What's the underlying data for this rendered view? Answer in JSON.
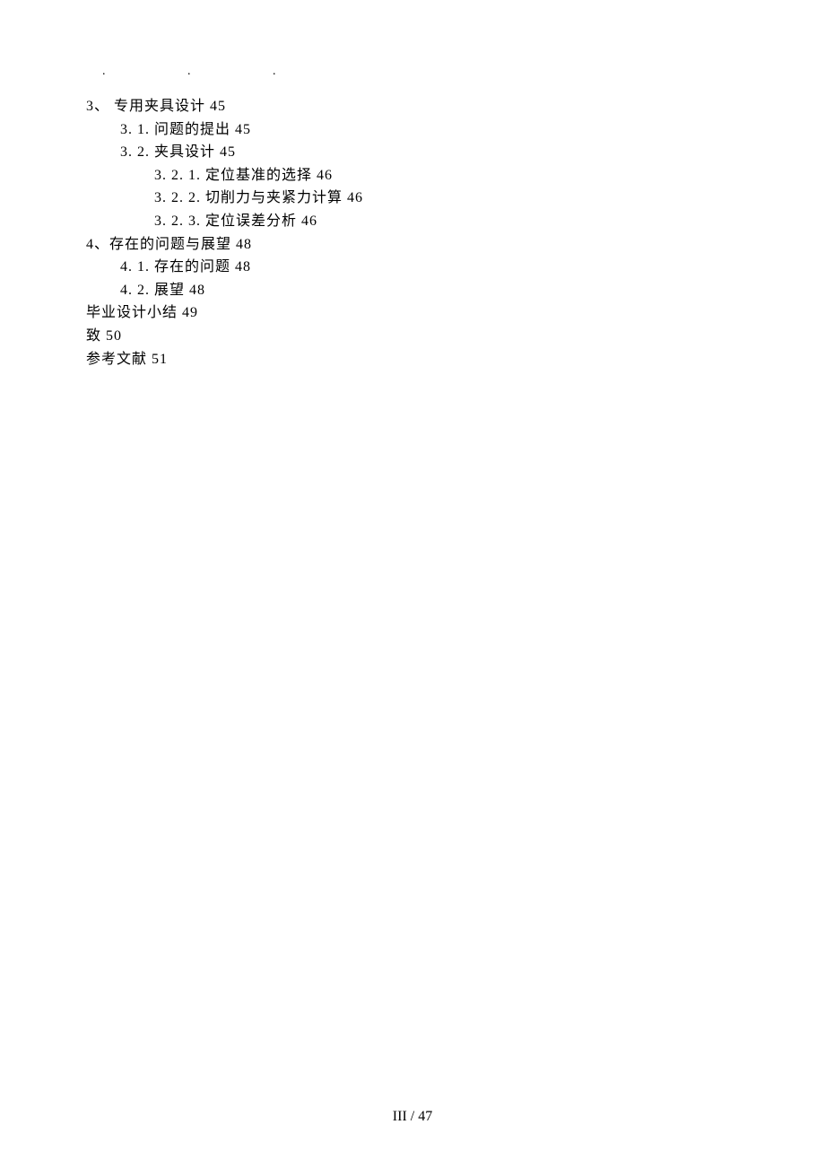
{
  "dots": ".   .   .",
  "toc": [
    {
      "indent": 0,
      "text": "3、 专用夹具设计 45"
    },
    {
      "indent": 1,
      "text": "3. 1. 问题的提出 45"
    },
    {
      "indent": 1,
      "text": "3. 2. 夹具设计 45"
    },
    {
      "indent": 2,
      "text": "3. 2. 1. 定位基准的选择 46"
    },
    {
      "indent": 2,
      "text": "3. 2. 2. 切削力与夹紧力计算 46"
    },
    {
      "indent": 2,
      "text": "3. 2. 3. 定位误差分析 46"
    },
    {
      "indent": 0,
      "text": "4、存在的问题与展望 48"
    },
    {
      "indent": 1,
      "text": "4. 1. 存在的问题 48"
    },
    {
      "indent": 1,
      "text": "4. 2. 展望 48"
    },
    {
      "indent": 0,
      "text": "毕业设计小结 49"
    },
    {
      "indent": 0,
      "text": "致 50"
    },
    {
      "indent": 0,
      "text": "参考文献 51"
    }
  ],
  "footer": "III  / 47"
}
